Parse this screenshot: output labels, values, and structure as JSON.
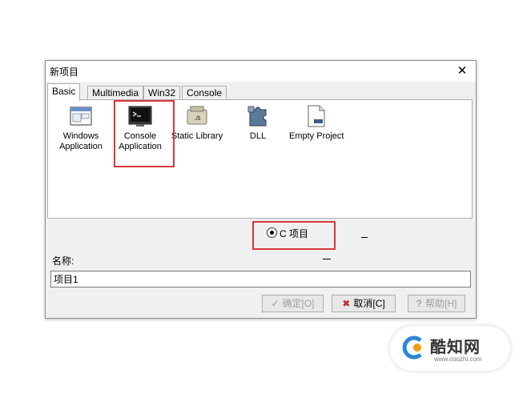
{
  "dialog": {
    "title": "新项目",
    "tabs": [
      "Basic",
      "Multimedia",
      "Win32",
      "Console"
    ],
    "projects": [
      {
        "label_line1": "Windows",
        "label_line2": "Application",
        "icon": "window-app-icon"
      },
      {
        "label_line1": "Console",
        "label_line2": "Application",
        "icon": "console-app-icon"
      },
      {
        "label_line1": "Static Library",
        "label_line2": "",
        "icon": "static-library-icon"
      },
      {
        "label_line1": "DLL",
        "label_line2": "",
        "icon": "dll-puzzle-icon"
      },
      {
        "label_line1": "Empty Project",
        "label_line2": "",
        "icon": "empty-project-icon"
      }
    ],
    "language_option": "C 项目",
    "name_label": "名称:",
    "name_value": "项目1",
    "buttons": {
      "ok": "确定[O]",
      "cancel": "取消[C]",
      "help": "帮助[H]"
    }
  },
  "watermark": {
    "name": "酷知网",
    "url": "www.coozhi.com"
  },
  "colors": {
    "highlight": "#d9383a",
    "dialog_bg": "#f0f0f0"
  }
}
